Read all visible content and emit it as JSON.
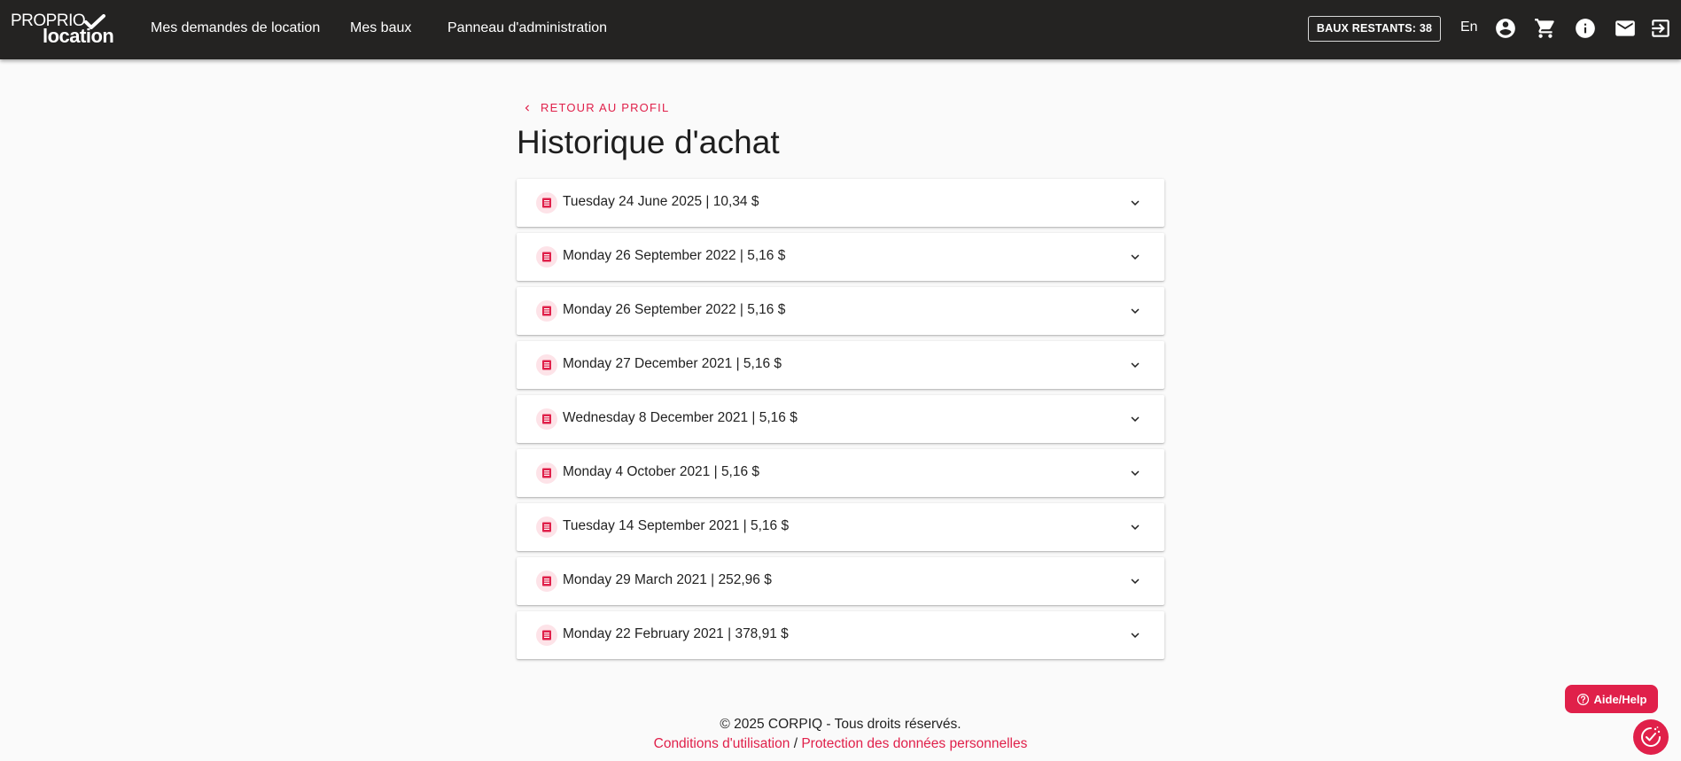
{
  "header": {
    "logo_top": "PROPRIO",
    "logo_bottom": "location",
    "nav": [
      {
        "label": "Mes demandes de location"
      },
      {
        "label": "Mes baux"
      },
      {
        "label": "Panneau d'administration"
      }
    ],
    "baux_button": "BAUX RESTANTS: 38",
    "language": "En",
    "icons": [
      "account-icon",
      "cart-icon",
      "info-icon",
      "mail-icon",
      "logout-icon"
    ]
  },
  "main": {
    "back_link": "RETOUR AU PROFIL",
    "title": "Historique d'achat",
    "purchases": [
      {
        "label": "Tuesday 24 June 2025 | 10,34 $"
      },
      {
        "label": "Monday 26 September 2022 | 5,16 $"
      },
      {
        "label": "Monday 26 September 2022 | 5,16 $"
      },
      {
        "label": "Monday 27 December 2021 | 5,16 $"
      },
      {
        "label": "Wednesday 8 December 2021 | 5,16 $"
      },
      {
        "label": "Monday 4 October 2021 | 5,16 $"
      },
      {
        "label": "Tuesday 14 September 2021 | 5,16 $"
      },
      {
        "label": "Monday 29 March 2021 | 252,96 $"
      },
      {
        "label": "Monday 22 February 2021 | 378,91 $"
      }
    ]
  },
  "footer": {
    "copyright": "© 2025 CORPIQ - Tous droits réservés.",
    "terms_link": "Conditions d'utilisation",
    "separator": "/",
    "privacy_link": "Protection des données personnelles"
  },
  "help_button": "Aide/Help",
  "colors": {
    "accent": "#e0204a",
    "header_bg": "#242322",
    "page_bg": "#fafafa"
  }
}
